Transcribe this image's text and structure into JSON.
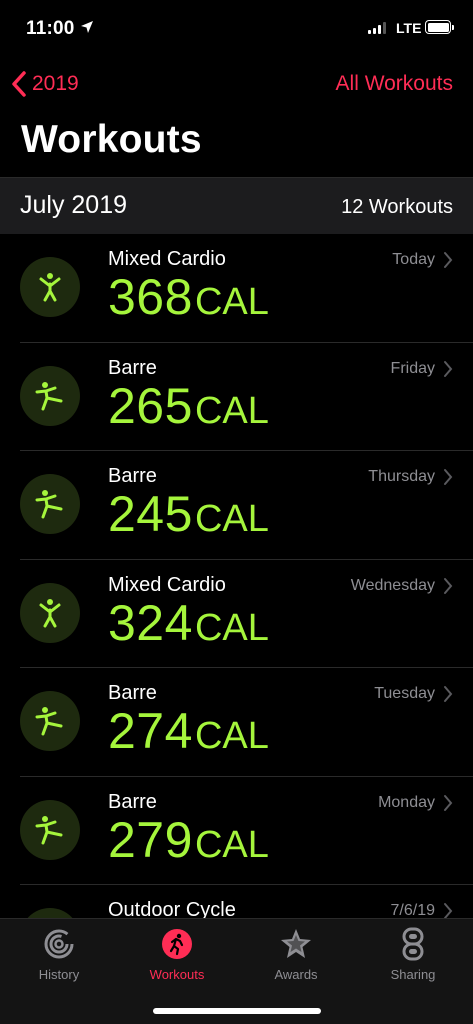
{
  "status": {
    "time": "11:00",
    "network": "LTE"
  },
  "nav": {
    "back_label": "2019",
    "right_label": "All Workouts"
  },
  "title": "Workouts",
  "section": {
    "month": "July 2019",
    "count": "12 Workouts"
  },
  "workouts": [
    {
      "type": "Mixed Cardio",
      "calories": "368",
      "unit": "CAL",
      "date": "Today",
      "icon": "mixed-cardio-icon"
    },
    {
      "type": "Barre",
      "calories": "265",
      "unit": "CAL",
      "date": "Friday",
      "icon": "barre-icon"
    },
    {
      "type": "Barre",
      "calories": "245",
      "unit": "CAL",
      "date": "Thursday",
      "icon": "barre-icon"
    },
    {
      "type": "Mixed Cardio",
      "calories": "324",
      "unit": "CAL",
      "date": "Wednesday",
      "icon": "mixed-cardio-icon"
    },
    {
      "type": "Barre",
      "calories": "274",
      "unit": "CAL",
      "date": "Tuesday",
      "icon": "barre-icon"
    },
    {
      "type": "Barre",
      "calories": "279",
      "unit": "CAL",
      "date": "Monday",
      "icon": "barre-icon"
    },
    {
      "type": "Outdoor Cycle",
      "calories": "",
      "unit": "",
      "date": "7/6/19",
      "icon": "cycle-icon"
    }
  ],
  "tabs": [
    {
      "label": "History",
      "icon": "history-rings-icon"
    },
    {
      "label": "Workouts",
      "icon": "workout-runner-icon",
      "active": true
    },
    {
      "label": "Awards",
      "icon": "award-star-icon"
    },
    {
      "label": "Sharing",
      "icon": "sharing-icon"
    }
  ],
  "colors": {
    "accent": "#ff2d55",
    "calories": "#a5f53c",
    "background": "#000000"
  }
}
